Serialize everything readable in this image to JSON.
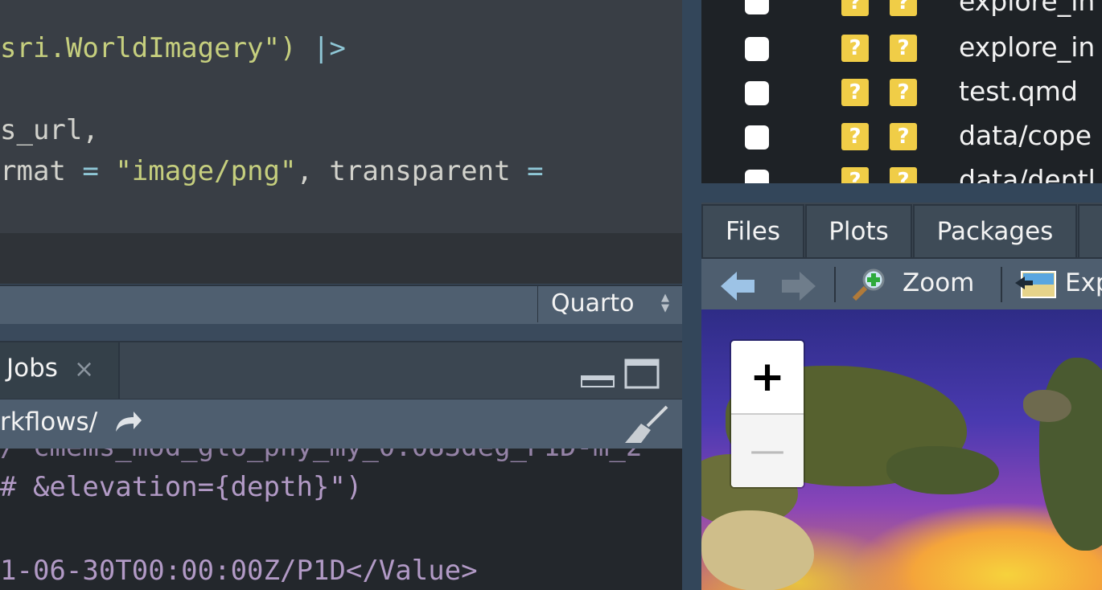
{
  "editor": {
    "lines": [
      {
        "parts": [
          {
            "t": "sri.WorldImagery",
            "c": "str"
          },
          {
            "t": "\")",
            "c": "str"
          },
          {
            "t": " |>",
            "c": "op"
          }
        ]
      },
      {
        "parts": [
          {
            "t": "s_url,",
            "c": "plain"
          }
        ]
      },
      {
        "parts": [
          {
            "t": "rmat ",
            "c": "plain"
          },
          {
            "t": "=",
            "c": "op"
          },
          {
            "t": " \"image/png\"",
            "c": "str"
          },
          {
            "t": ", transparent ",
            "c": "plain"
          },
          {
            "t": "=",
            "c": "op"
          }
        ]
      }
    ],
    "status_mode": "Quarto"
  },
  "console": {
    "tab_label": "Jobs",
    "tab_close": "×",
    "path": "rkflows/",
    "lines": [
      "/ cmems_mod_glo_phy_my_0.083deg_P1D-m_2",
      "# &elevation={depth}\")",
      "",
      "1-06-30T00:00:00Z/P1D</Value>"
    ]
  },
  "git": {
    "badge": "?",
    "files": [
      "explore_in",
      "explore_in",
      "test.qmd",
      "data/cope",
      "data/deptl"
    ]
  },
  "viewer": {
    "tabs": [
      "Files",
      "Plots",
      "Packages"
    ],
    "zoom_label": "Zoom",
    "export_label": "Exp",
    "zoom_in": "+",
    "zoom_out": "—"
  },
  "colors": {
    "badge": "#f0cd47",
    "accent": "#4e5e6f"
  }
}
